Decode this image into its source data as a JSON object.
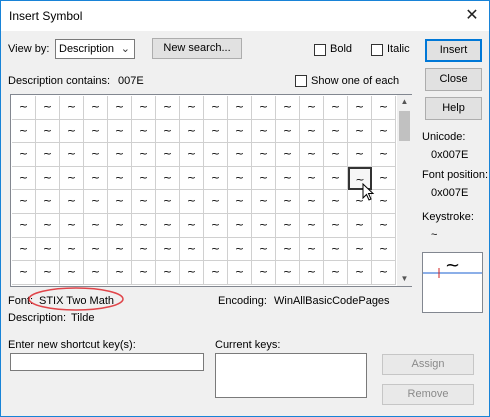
{
  "window": {
    "title": "Insert Symbol",
    "close_glyph": "✕"
  },
  "view_by": {
    "label": "View by:",
    "value": "Description"
  },
  "buttons": {
    "new_search": "New search...",
    "insert": "Insert",
    "close": "Close",
    "help": "Help",
    "assign": "Assign",
    "remove": "Remove"
  },
  "checkboxes": {
    "bold": "Bold",
    "italic": "Italic",
    "show_one": "Show one of each"
  },
  "description_contains": {
    "label": "Description contains:",
    "value": "007E"
  },
  "symbols": [
    [
      "~",
      "~",
      "~",
      "~",
      "~",
      "~",
      "~",
      "~",
      "~",
      "~",
      "~",
      "~",
      "~",
      "~",
      "~",
      "~"
    ],
    [
      "~",
      "~",
      "~",
      "~",
      "~",
      "~",
      "~",
      "~",
      "~",
      "~",
      "~",
      "~",
      "~",
      "~",
      "~",
      "~"
    ],
    [
      "~",
      "~",
      "~",
      "~",
      "~",
      "~",
      "~",
      "~",
      "~",
      "~",
      "~",
      "~",
      "~",
      "~",
      "~",
      "~"
    ],
    [
      "~",
      "~",
      "~",
      "~",
      "~",
      "~",
      "~",
      "~",
      "~",
      "~",
      "~",
      "~",
      "~",
      "~",
      "~",
      "~"
    ],
    [
      "~",
      "~",
      "~",
      "~",
      "~",
      "~",
      "~",
      "~",
      "~",
      "~",
      "~",
      "~",
      "~",
      "~",
      "~",
      "~"
    ],
    [
      "~",
      "~",
      "~",
      "~",
      "~",
      "~",
      "~",
      "~",
      "~",
      "~",
      "~",
      "~",
      "~",
      "~",
      "~",
      "~"
    ],
    [
      "~",
      "~",
      "~",
      "~",
      "~",
      "~",
      "~",
      "~",
      "~",
      "~",
      "~",
      "~",
      "~",
      "~",
      "~",
      "~"
    ],
    [
      "~",
      "~",
      "~",
      "~",
      "~",
      "~",
      "~",
      "~",
      "~",
      "~",
      "~",
      "~",
      "~",
      "~",
      "~",
      "~"
    ]
  ],
  "selected_cell": {
    "row": 3,
    "col": 14
  },
  "info": {
    "unicode_label": "Unicode:",
    "unicode_value": "0x007E",
    "font_position_label": "Font position:",
    "font_position_value": "0x007E",
    "keystroke_label": "Keystroke:",
    "keystroke_value": "~"
  },
  "preview_glyph": "~",
  "font": {
    "label": "Font:",
    "value": "STIX Two Math"
  },
  "encoding": {
    "label": "Encoding:",
    "value": "WinAllBasicCodePages"
  },
  "description": {
    "label": "Description:",
    "value": "Tilde"
  },
  "shortcut": {
    "label": "Enter new shortcut key(s):",
    "value": ""
  },
  "current_keys": {
    "label": "Current keys:"
  },
  "colors": {
    "accent": "#0078d7",
    "annotation_circle": "#e0454a"
  }
}
